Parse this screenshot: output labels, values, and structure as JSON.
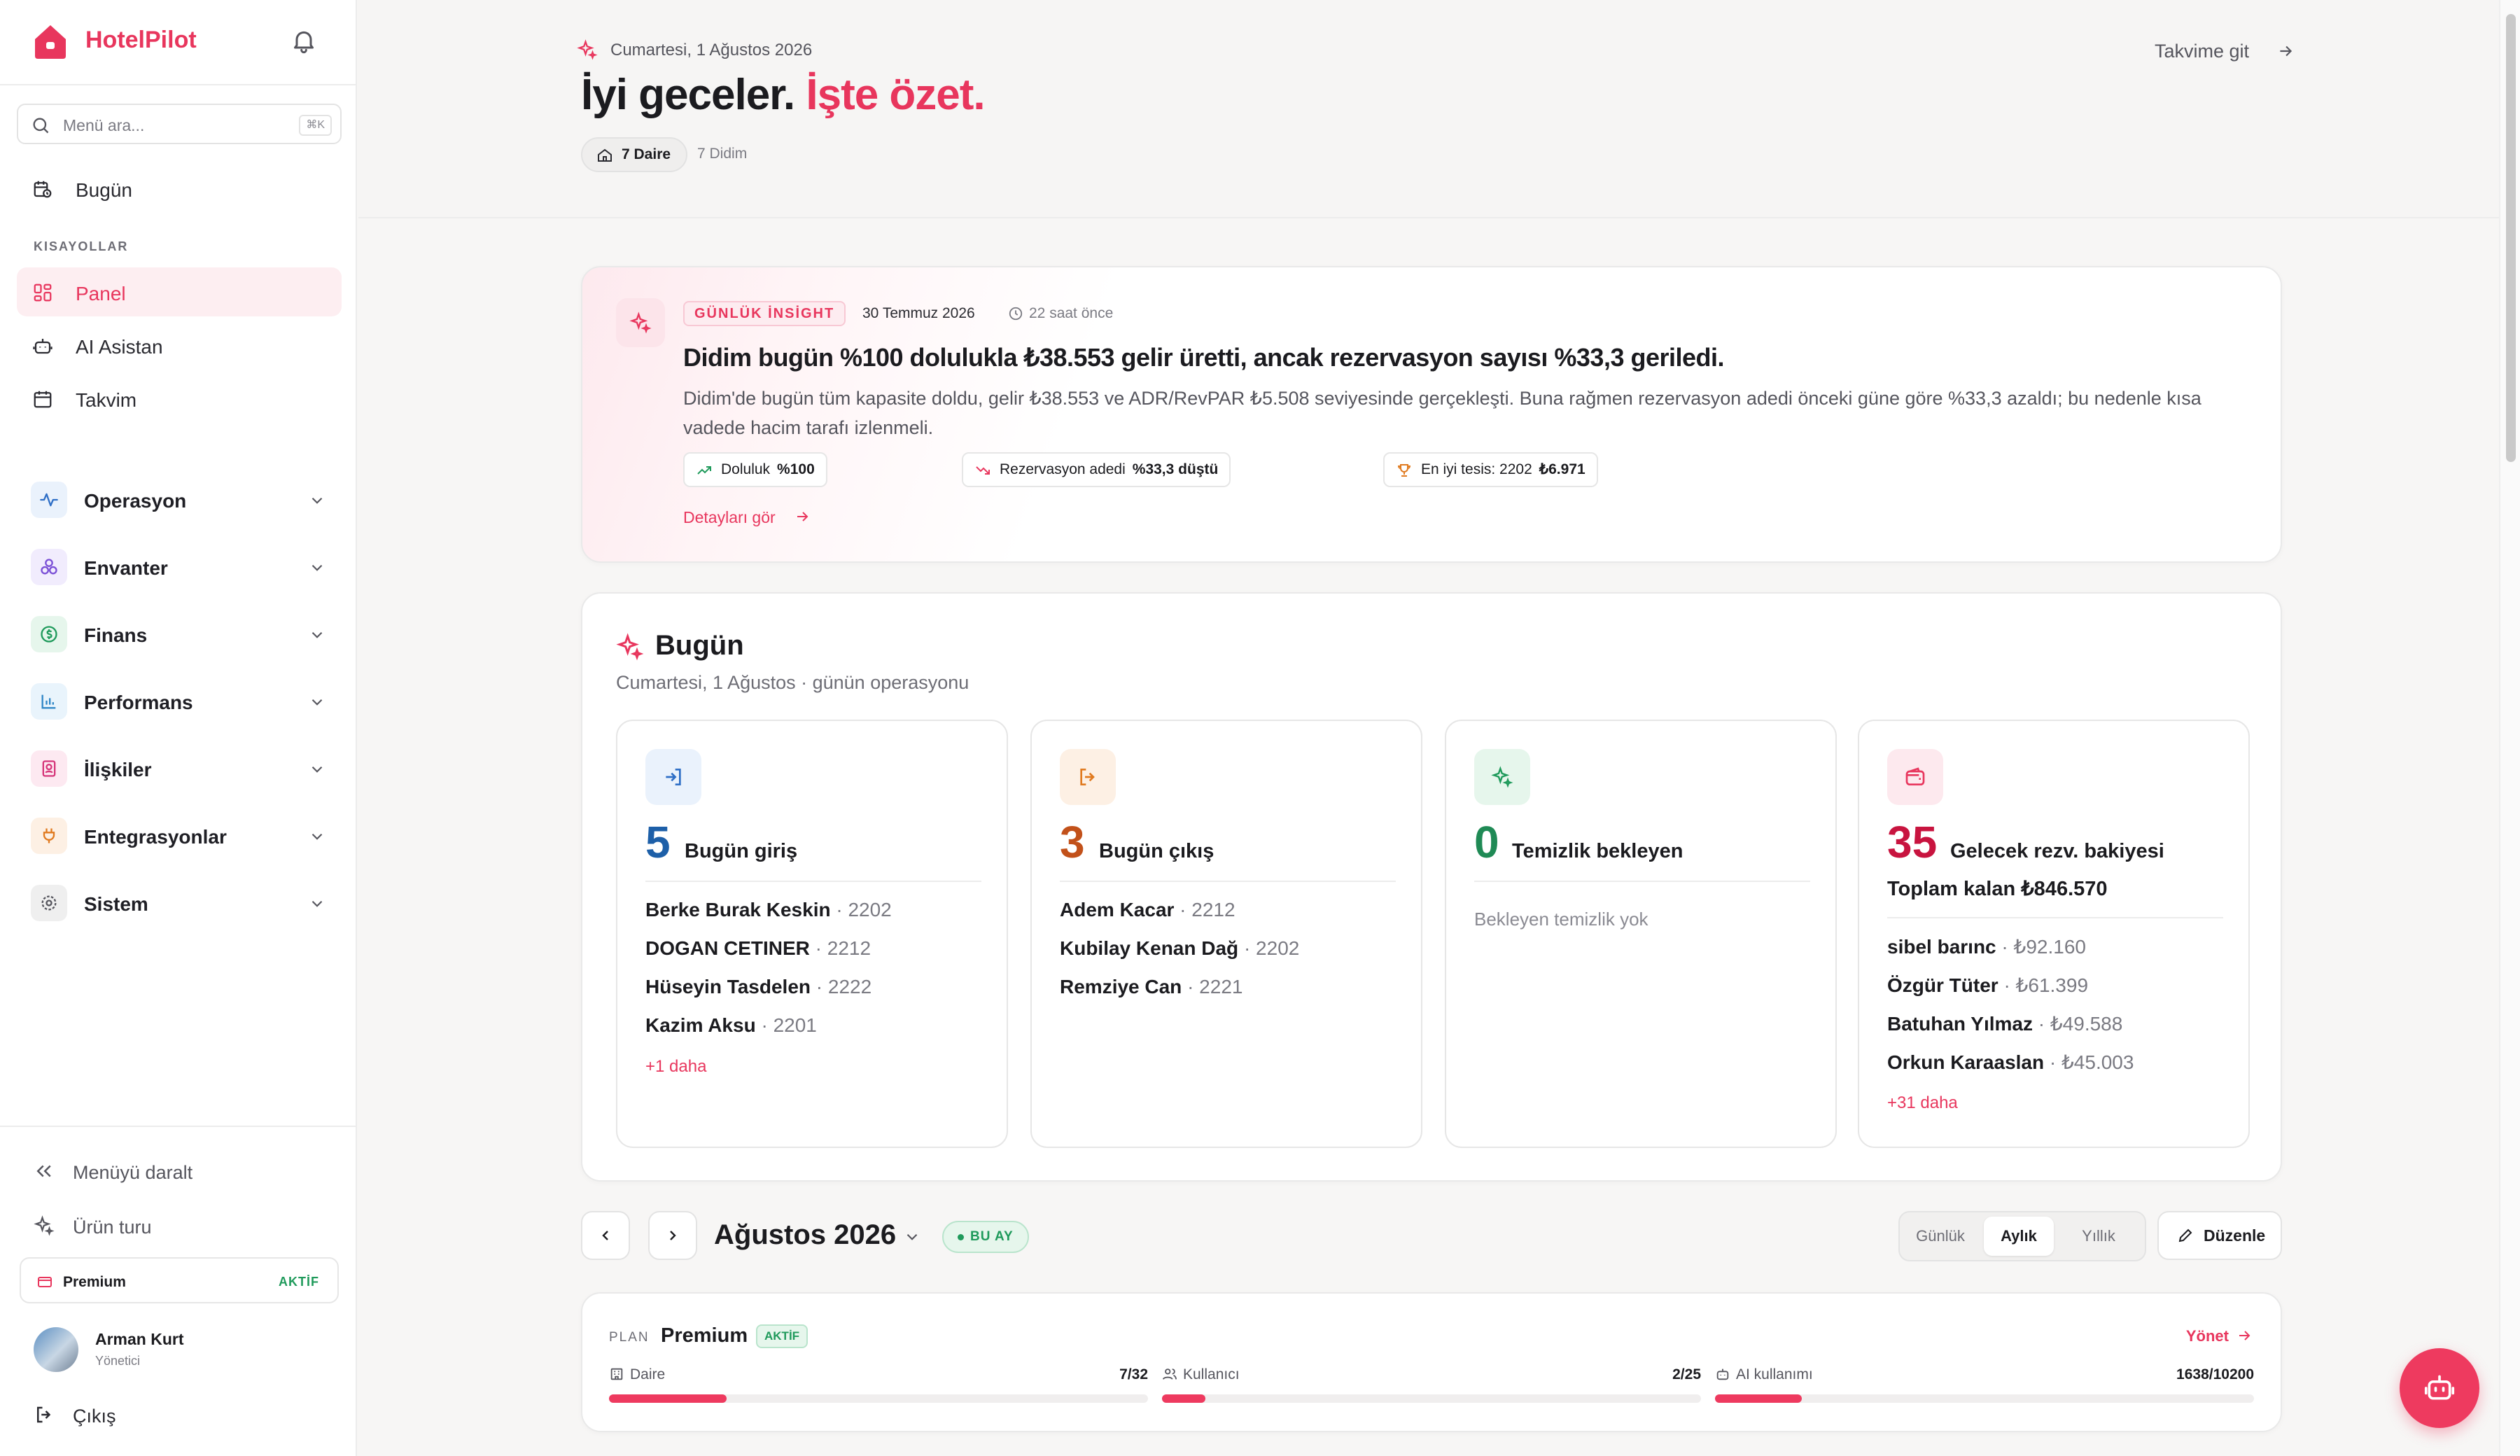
{
  "brand": {
    "name": "HotelPilot",
    "accent": "#e8365d"
  },
  "search": {
    "placeholder": "Menü ara...",
    "shortcut": "⌘K"
  },
  "nav": {
    "today": "Bugün",
    "shortcuts_label": "KISAYOLLAR",
    "shortcuts": [
      "Panel",
      "AI Asistan",
      "Takvim"
    ],
    "groups": [
      "Operasyon",
      "Envanter",
      "Finans",
      "Performans",
      "İlişkiler",
      "Entegrasyonlar",
      "Sistem"
    ]
  },
  "footer": {
    "collapse": "Menüyü daralt",
    "tour": "Ürün turu",
    "plan_name": "Premium",
    "plan_status": "AKTİF",
    "user_name": "Arman Kurt",
    "user_role": "Yönetici",
    "logout": "Çıkış"
  },
  "header": {
    "date": "Cumartesi, 1 Ağustos 2026",
    "greeting_a": "İyi geceler.",
    "greeting_b": "İşte özet.",
    "scope_pill": "7 Daire",
    "location": "7 Didim",
    "calendar_link": "Takvime git"
  },
  "insight": {
    "badge": "GÜNLÜK İNSİGHT",
    "date": "30 Temmuz 2026",
    "ago": "22 saat önce",
    "title": "Didim bugün %100 dolulukla ₺38.553 gelir üretti, ancak rezervasyon sayısı %33,3 geriledi.",
    "body": "Didim'de bugün tüm kapasite doldu, gelir ₺38.553 ve ADR/RevPAR ₺5.508 seviyesinde gerçekleşti. Buna rağmen rezervasyon adedi önceki güne göre %33,3 azaldı; bu nedenle kısa vadede hacim tarafı izlenmeli.",
    "metrics": [
      {
        "label": "Doluluk",
        "value": "%100"
      },
      {
        "label": "Rezervasyon adedi",
        "value": "%33,3 düştü"
      },
      {
        "label": "En iyi tesis: 2202",
        "value": "₺6.971"
      }
    ],
    "details_link": "Detayları gör"
  },
  "today": {
    "title": "Bugün",
    "subtitle": "Cumartesi, 1 Ağustos · günün operasyonu",
    "checkin": {
      "count": "5",
      "label": "Bugün giriş",
      "color": "#1d5fa8",
      "rows": [
        {
          "name": "Berke Burak Keskin",
          "meta": " · 2202"
        },
        {
          "name": "DOGAN CETINER",
          "meta": " · 2212"
        },
        {
          "name": "Hüseyin Tasdelen",
          "meta": " · 2222"
        },
        {
          "name": "Kazim Aksu",
          "meta": " · 2201"
        }
      ],
      "more": "+1 daha"
    },
    "checkout": {
      "count": "3",
      "label": "Bugün çıkış",
      "color": "#c2511a",
      "rows": [
        {
          "name": "Adem Kacar",
          "meta": " · 2212"
        },
        {
          "name": "Kubilay Kenan Dağ",
          "meta": " · 2202"
        },
        {
          "name": "Remziye Can",
          "meta": " · 2221"
        }
      ]
    },
    "cleaning": {
      "count": "0",
      "label": "Temizlik bekleyen",
      "color": "#1f8a55",
      "empty": "Bekleyen temizlik yok"
    },
    "balance": {
      "count": "35",
      "label": "Gelecek rezv. bakiyesi",
      "color": "#c8143f",
      "total": "Toplam kalan ₺846.570",
      "rows": [
        {
          "name": "sibel barınc",
          "meta": " · ₺92.160"
        },
        {
          "name": "Özgür Tüter",
          "meta": " · ₺61.399"
        },
        {
          "name": "Batuhan Yılmaz",
          "meta": " · ₺49.588"
        },
        {
          "name": "Orkun Karaaslan",
          "meta": " · ₺45.003"
        }
      ],
      "more": "+31 daha"
    }
  },
  "toolbar": {
    "month": "Ağustos 2026",
    "current_badge": "BU AY",
    "views": [
      "Günlük",
      "Aylık",
      "Yıllık"
    ],
    "active_view": "Aylık",
    "edit": "Düzenle"
  },
  "plan": {
    "label": "PLAN",
    "name": "Premium",
    "status": "AKTİF",
    "manage": "Yönet",
    "usage": [
      {
        "label": "Daire",
        "value": "7/32",
        "used": 7,
        "limit": 32
      },
      {
        "label": "Kullanıcı",
        "value": "2/25",
        "used": 2,
        "limit": 25
      },
      {
        "label": "AI kullanımı",
        "value": "1638/10200",
        "used": 1638,
        "limit": 10200
      }
    ]
  }
}
